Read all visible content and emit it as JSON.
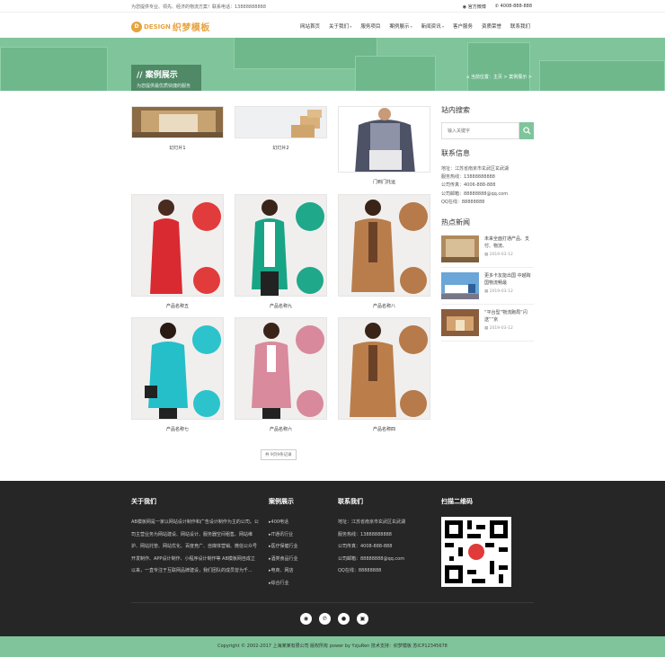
{
  "topbar": {
    "tagline": "为您提供专业、领先、经济的物流方案！联系电话：13888888888",
    "weibo": "官方微博",
    "phone": "4008-888-888"
  },
  "header": {
    "logo_en": "DESIGN",
    "logo_cn": "织梦模板",
    "nav": [
      "网站首页",
      "关于我们",
      "服务项目",
      "案例展示",
      "新闻资讯",
      "客户服务",
      "资质荣誉",
      "联系我们"
    ]
  },
  "banner": {
    "title": "// 案例展示",
    "subtitle": "为您提供最优质快捷的服务",
    "breadcrumb": "当前位置：主页 > 案例展示 >"
  },
  "products": [
    {
      "caption": "幻灯片1"
    },
    {
      "caption": "幻灯片2"
    },
    {
      "caption": "门到门托运"
    },
    {
      "caption": "产品名称五"
    },
    {
      "caption": "产品名称九"
    },
    {
      "caption": "产品名称八"
    },
    {
      "caption": "产品名称七"
    },
    {
      "caption": "产品名称六"
    },
    {
      "caption": "产品名称四"
    }
  ],
  "pager": "共 9页9条记录",
  "sidebar": {
    "search_title": "站内搜索",
    "search_placeholder": "输入关键字",
    "contact_title": "联系信息",
    "contact": [
      "地址：江苏省南京市玄武区玄武湖",
      "服务热线：13888888888",
      "公司传真：4006-888-888",
      "公司邮箱：88888888@qq.com",
      "QQ在线：88888888"
    ],
    "news_title": "热点新闻",
    "news": [
      {
        "title": "未来全面打通产品、支付、物流、",
        "date": "2019-03-12"
      },
      {
        "title": "更多卡友能出国 中越跨国物流畅最",
        "date": "2019-03-12"
      },
      {
        "title": "“平台型”物流跑局“闪送”“京",
        "date": "2019-03-12"
      }
    ]
  },
  "footer": {
    "about_title": "关于我们",
    "about_text": "AB模板网是一家以网站设计制作和广告设计制作为主的公司。公司主营业务为网站建设、网站设计、服务器空间租售、网站维护、网站托管、网站优化、百度竞广、自媒体营销、微信公众号开发制作、APP设计制作、小程序设计制作等 AB模板网自成立以来，一直专注于互联网品牌建设，我们团队的成员曾为千...",
    "cases_title": "案例展示",
    "cases": [
      "400电话",
      "IT通讯行业",
      "医疗保健行业",
      "酒类食品行业",
      "电商、网店",
      "综合行业"
    ],
    "contact_title": "联系我们",
    "contact": [
      "地址：江苏省南京市玄武区玄武湖",
      "服务热线：13888888888",
      "公司传真：4008-888-888",
      "公司邮箱：88888888@qq.com",
      "QQ在线：88888888"
    ],
    "qr_title": "扫描二维码",
    "copyright": "Copyright © 2002-2017 上海某某有限公司 版权所有 power by YzjuRen  技术支持：织梦模板  苏ICP12345678"
  }
}
